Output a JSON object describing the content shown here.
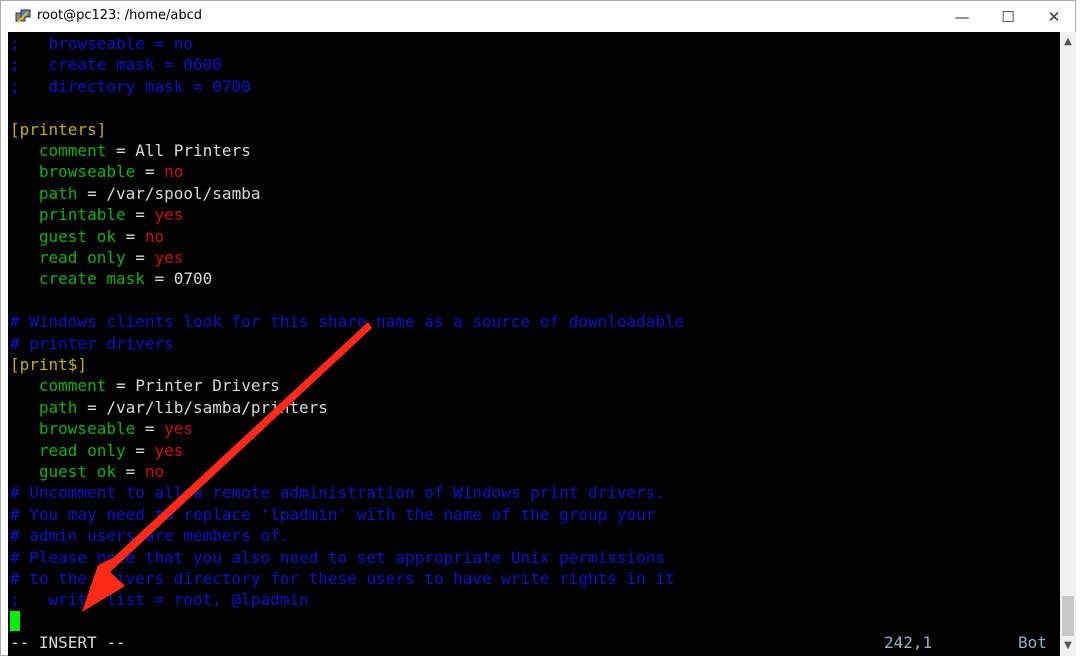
{
  "window": {
    "title": "root@pc123: /home/abcd",
    "controls": [
      "minimize",
      "maximize",
      "close"
    ]
  },
  "colors": {
    "comment": "#1010c8",
    "key": "#10b010",
    "section": "#c0b000",
    "value": "#c81010",
    "text": "#d8d8d8",
    "cursor": "#00ee00",
    "annotation_arrow": "#ff2a1a"
  },
  "lines": [
    [
      {
        "t": ";   browseable = no",
        "c": "comment"
      }
    ],
    [
      {
        "t": ";   create mask = 0600",
        "c": "comment"
      }
    ],
    [
      {
        "t": ";   directory mask = 0700",
        "c": "comment"
      }
    ],
    [],
    [
      {
        "t": "[printers]",
        "c": "sec"
      }
    ],
    [
      {
        "t": "   comment",
        "c": "key"
      },
      {
        "t": " = All Printers",
        "c": "txt"
      }
    ],
    [
      {
        "t": "   browseable",
        "c": "key"
      },
      {
        "t": " = ",
        "c": "txt"
      },
      {
        "t": "no",
        "c": "val"
      }
    ],
    [
      {
        "t": "   path",
        "c": "key"
      },
      {
        "t": " = /var/spool/samba",
        "c": "txt"
      }
    ],
    [
      {
        "t": "   printable",
        "c": "key"
      },
      {
        "t": " = ",
        "c": "txt"
      },
      {
        "t": "yes",
        "c": "val"
      }
    ],
    [
      {
        "t": "   guest ok",
        "c": "key"
      },
      {
        "t": " = ",
        "c": "txt"
      },
      {
        "t": "no",
        "c": "val"
      }
    ],
    [
      {
        "t": "   read only",
        "c": "key"
      },
      {
        "t": " = ",
        "c": "txt"
      },
      {
        "t": "yes",
        "c": "val"
      }
    ],
    [
      {
        "t": "   create mask",
        "c": "key"
      },
      {
        "t": " = 0700",
        "c": "txt"
      }
    ],
    [],
    [
      {
        "t": "# Windows clients look for this share name as a source of downloadable",
        "c": "comment"
      }
    ],
    [
      {
        "t": "# printer drivers",
        "c": "comment"
      }
    ],
    [
      {
        "t": "[print$]",
        "c": "sec"
      }
    ],
    [
      {
        "t": "   comment",
        "c": "key"
      },
      {
        "t": " = Printer Drivers",
        "c": "txt"
      }
    ],
    [
      {
        "t": "   path",
        "c": "key"
      },
      {
        "t": " = /var/lib/samba/printers",
        "c": "txt"
      }
    ],
    [
      {
        "t": "   browseable",
        "c": "key"
      },
      {
        "t": " = ",
        "c": "txt"
      },
      {
        "t": "yes",
        "c": "val"
      }
    ],
    [
      {
        "t": "   read only",
        "c": "key"
      },
      {
        "t": " = ",
        "c": "txt"
      },
      {
        "t": "yes",
        "c": "val"
      }
    ],
    [
      {
        "t": "   guest ok",
        "c": "key"
      },
      {
        "t": " = ",
        "c": "txt"
      },
      {
        "t": "no",
        "c": "val"
      }
    ],
    [
      {
        "t": "# Uncomment to allow remote administration of Windows print drivers.",
        "c": "comment"
      }
    ],
    [
      {
        "t": "# You may need to replace 'lpadmin' with the name of the group your",
        "c": "comment"
      }
    ],
    [
      {
        "t": "# admin users are members of.",
        "c": "comment"
      }
    ],
    [
      {
        "t": "# Please note that you also need to set appropriate Unix permissions",
        "c": "comment"
      }
    ],
    [
      {
        "t": "# to the drivers directory for these users to have write rights in it",
        "c": "comment"
      }
    ],
    [
      {
        "t": ";   write list = root, @lpadmin",
        "c": "comment"
      }
    ]
  ],
  "statusbar": {
    "mode": "-- INSERT --",
    "position": "242,1",
    "scroll": "Bot"
  }
}
